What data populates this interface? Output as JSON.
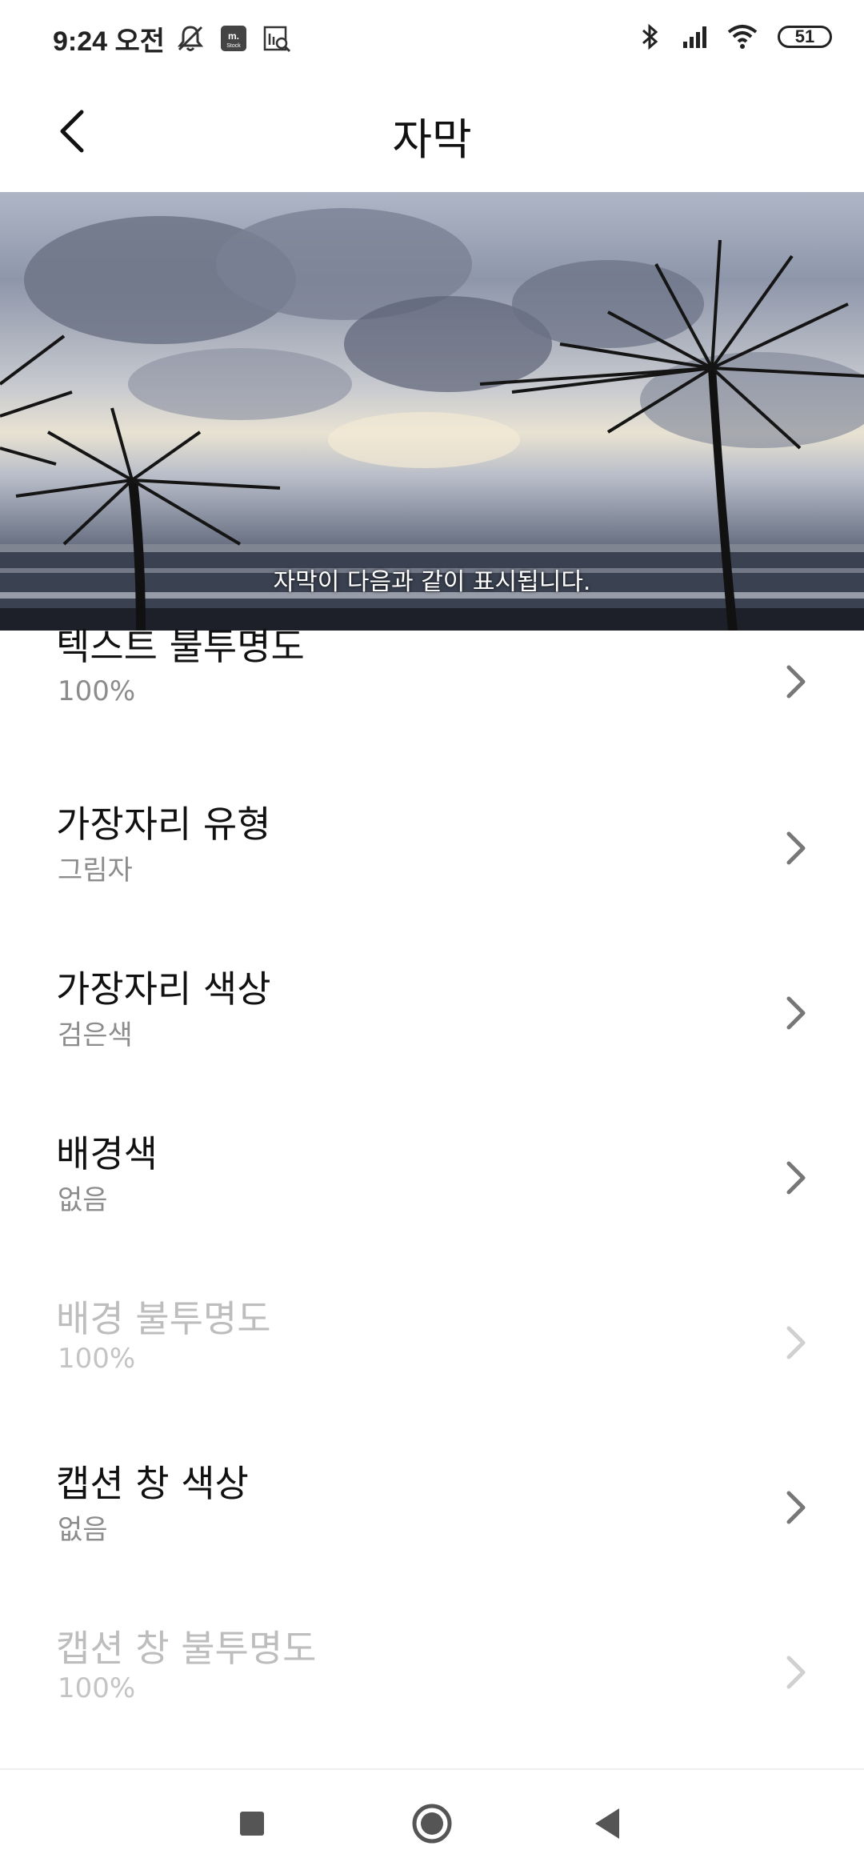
{
  "status_bar": {
    "time": "9:24 오전",
    "battery": "51",
    "icons": [
      "notifications-off-icon",
      "mstock-app-icon",
      "screen-search-icon",
      "bluetooth-icon",
      "signal-icon",
      "wifi-icon",
      "battery-icon"
    ]
  },
  "header": {
    "title": "자막",
    "back_icon": "back-arrow-icon"
  },
  "preview": {
    "caption": "자막이 다음과 같이 표시됩니다."
  },
  "settings": [
    {
      "title": "텍스트 불투명도",
      "value": "100%",
      "enabled": true
    },
    {
      "title": "가장자리 유형",
      "value": "그림자",
      "enabled": true
    },
    {
      "title": "가장자리 색상",
      "value": "검은색",
      "enabled": true
    },
    {
      "title": "배경색",
      "value": "없음",
      "enabled": true
    },
    {
      "title": "배경 불투명도",
      "value": "100%",
      "enabled": false
    },
    {
      "title": "캡션 창 색상",
      "value": "없음",
      "enabled": true
    },
    {
      "title": "캡션 창 불투명도",
      "value": "100%",
      "enabled": false
    }
  ],
  "nav_bar": {
    "icons": [
      "recents-square-icon",
      "home-circle-icon",
      "back-triangle-icon"
    ]
  }
}
